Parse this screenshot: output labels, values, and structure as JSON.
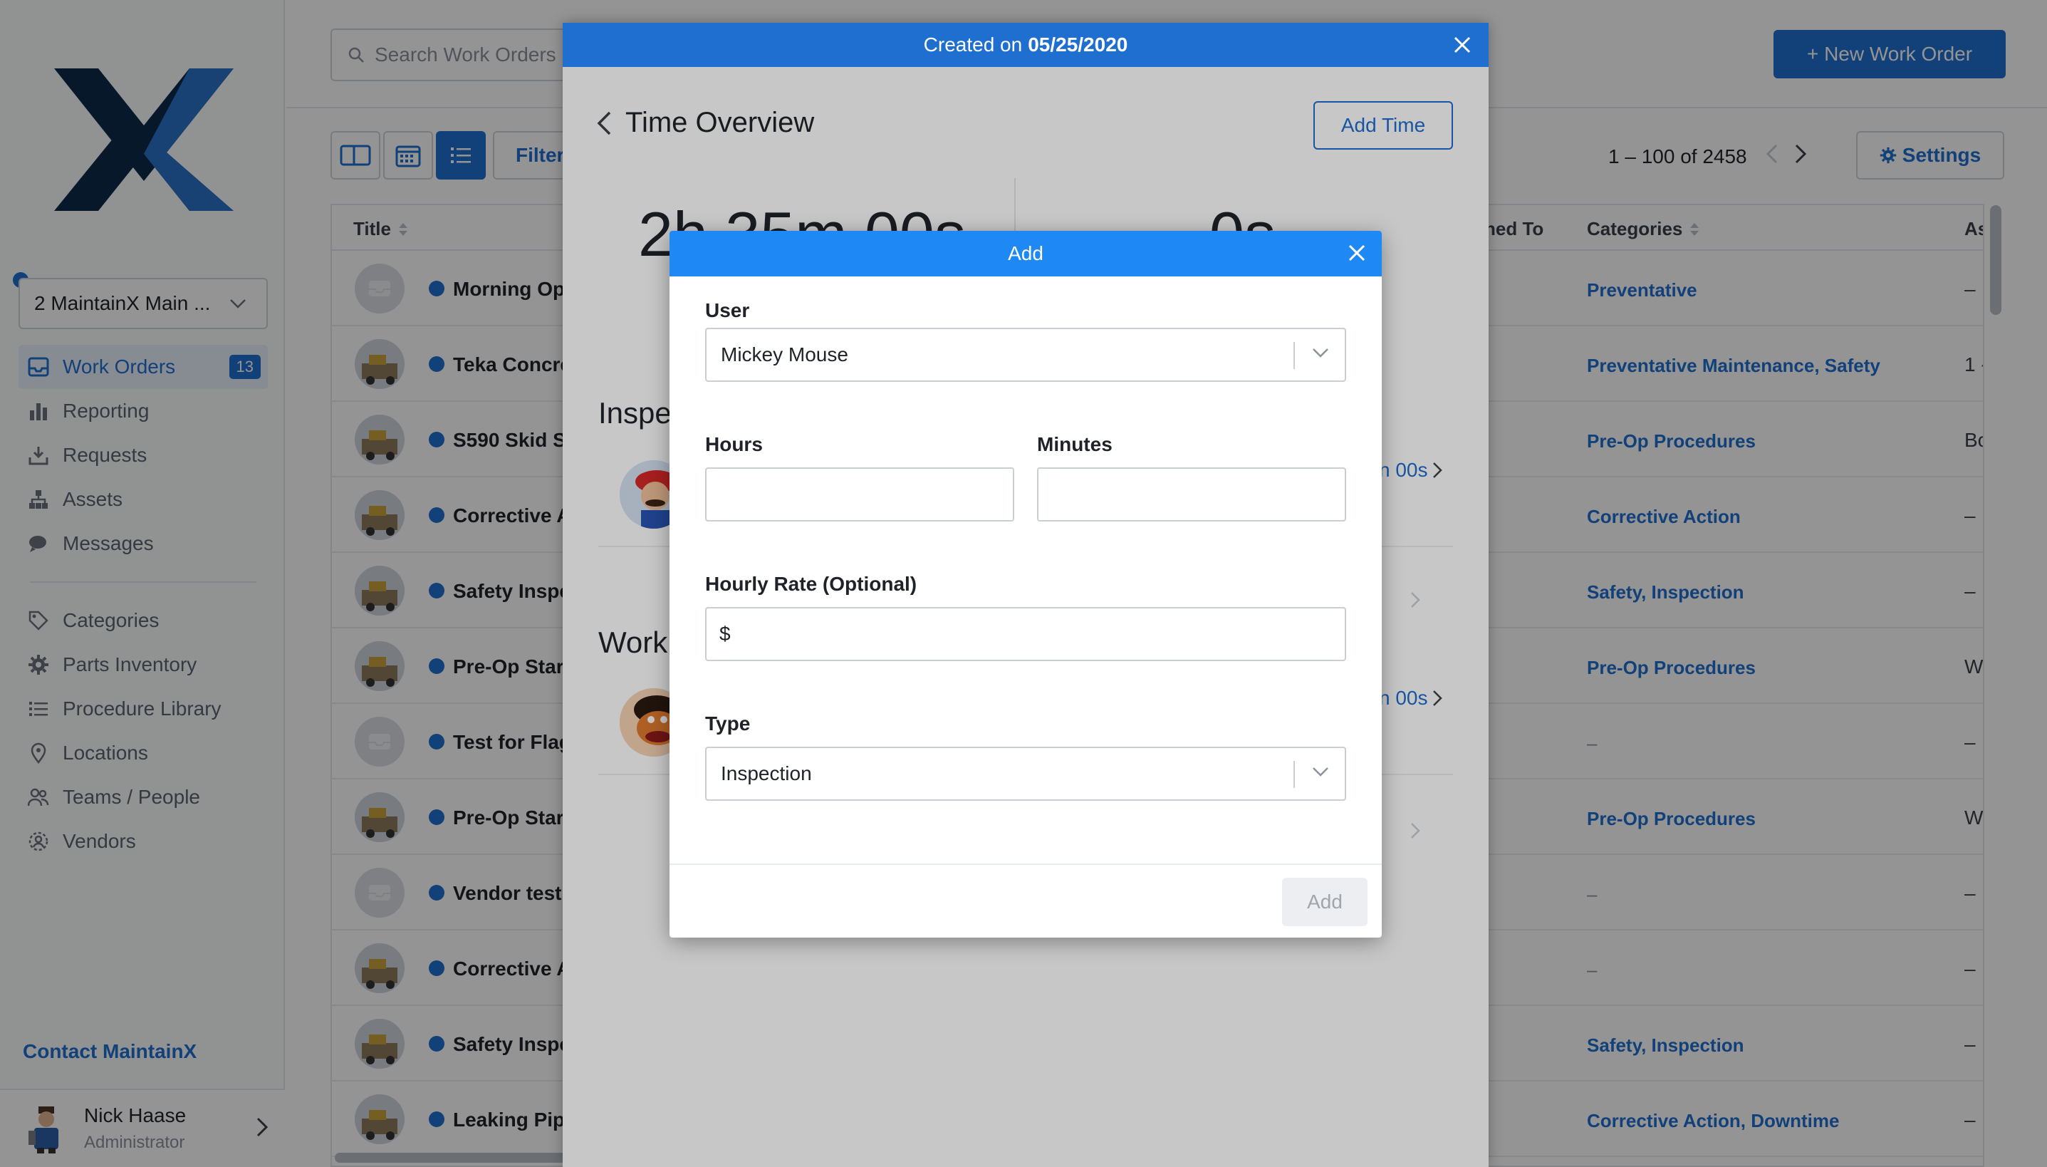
{
  "sidebar": {
    "location": "2 MaintainX Main ...",
    "nav": [
      {
        "label": "Work Orders",
        "icon": "inbox-icon",
        "badge": "13",
        "active": true
      },
      {
        "label": "Reporting",
        "icon": "bar-chart-icon"
      },
      {
        "label": "Requests",
        "icon": "tray-download-icon"
      },
      {
        "label": "Assets",
        "icon": "hierarchy-icon"
      },
      {
        "label": "Messages",
        "icon": "chat-bubbles-icon"
      }
    ],
    "nav2": [
      {
        "label": "Categories",
        "icon": "tag-icon"
      },
      {
        "label": "Parts Inventory",
        "icon": "gear-icon"
      },
      {
        "label": "Procedure Library",
        "icon": "list-icon"
      },
      {
        "label": "Locations",
        "icon": "map-pin-icon"
      },
      {
        "label": "Teams / People",
        "icon": "people-icon"
      },
      {
        "label": "Vendors",
        "icon": "vendors-icon"
      }
    ],
    "contact": "Contact MaintainX",
    "user": {
      "name": "Nick Haase",
      "role": "Administrator"
    }
  },
  "topbar": {
    "search_placeholder": "Search Work Orders",
    "new_work_order": "+ New Work Order"
  },
  "toolbar": {
    "filter": "Filter",
    "pagination": "1 – 100 of 2458",
    "settings": "Settings"
  },
  "table": {
    "headers": {
      "title": "Title",
      "assigned": "ned To",
      "categories": "Categories",
      "as": "As"
    },
    "rows": [
      {
        "title": "Morning Op",
        "thumb": "placeholder",
        "category": "Preventative",
        "as": "–"
      },
      {
        "title": "Teka Concre",
        "thumb": "photo",
        "category": "Preventative Maintenance, Safety",
        "as": "1 -"
      },
      {
        "title": "S590 Skid S",
        "thumb": "photo",
        "category": "Pre-Op Procedures",
        "as": "Bo"
      },
      {
        "title": "Corrective A",
        "thumb": "photo",
        "category": "Corrective Action",
        "as": "–"
      },
      {
        "title": "Safety Inspe",
        "thumb": "photo",
        "category": "Safety, Inspection",
        "as": "–"
      },
      {
        "title": "Pre-Op Star",
        "thumb": "photo",
        "category": "Pre-Op Procedures",
        "as": "W"
      },
      {
        "title": "Test for Flag",
        "thumb": "placeholder",
        "category": "–",
        "as": "–"
      },
      {
        "title": "Pre-Op Star",
        "thumb": "photo",
        "category": "Pre-Op Procedures",
        "as": "W"
      },
      {
        "title": "Vendor test",
        "thumb": "placeholder",
        "category": "–",
        "as": "–"
      },
      {
        "title": "Corrective A",
        "thumb": "photo",
        "category": "–",
        "as": "–"
      },
      {
        "title": "Safety Inspe",
        "thumb": "photo",
        "category": "Safety, Inspection",
        "as": "–"
      },
      {
        "title": "Leaking Pip",
        "thumb": "photo",
        "category": "Corrective Action, Downtime",
        "as": "–"
      }
    ]
  },
  "panel": {
    "created_prefix": "Created on",
    "created_date": "05/25/2020",
    "title": "Time Overview",
    "add_time": "Add Time",
    "total_time": "2h 35m 00s",
    "other_time": "0s",
    "section_inspection": "Inspe",
    "section_work": "Work",
    "inspection_duration": "n 00s",
    "work_duration": "n 00s"
  },
  "modal": {
    "title": "Add",
    "user_label": "User",
    "user_value": "Mickey Mouse",
    "hours_label": "Hours",
    "hours_value": "",
    "minutes_label": "Minutes",
    "minutes_value": "",
    "rate_label": "Hourly Rate (Optional)",
    "rate_prefix": "$",
    "type_label": "Type",
    "type_value": "Inspection",
    "submit": "Add"
  },
  "colors": {
    "brand": "#1f6fd1",
    "modal_header": "#1e88f5",
    "logo_dark": "#0f2a4a"
  }
}
